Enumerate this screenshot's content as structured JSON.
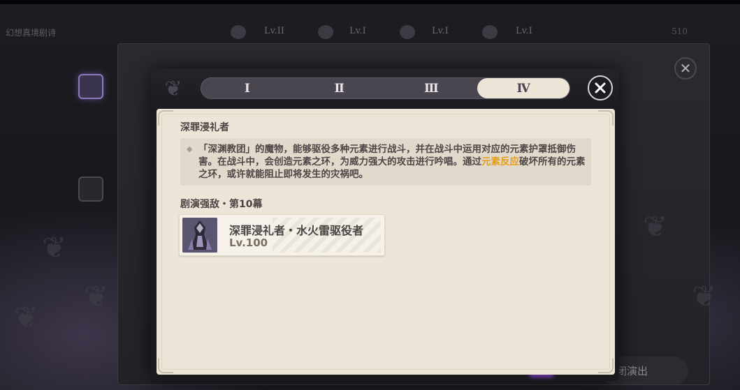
{
  "background": {
    "top_strip": {
      "title": "幻想真境剧诗",
      "levels": [
        "Lv.II",
        "Lv.I",
        "Lv.I",
        "Lv.I"
      ],
      "right_number": "510"
    },
    "bottom_button_label": "闭演出"
  },
  "tabs": [
    {
      "label": "Ⅰ",
      "active": false
    },
    {
      "label": "Ⅱ",
      "active": false
    },
    {
      "label": "Ⅲ",
      "active": false
    },
    {
      "label": "Ⅳ",
      "active": true
    }
  ],
  "enemy": {
    "title": "深罪浸礼者",
    "description_parts": [
      "「深渊教团」的魔物，能够驱役多种元素进行战斗，并在战斗中运用对应的元素护罩抵御伤害。在战斗中，会创造元素之环，为威力强大的攻击进行吟唱。通过",
      "元素反应",
      "破坏所有的元素之环，或许就能阻止即将发生的灾祸吧。"
    ]
  },
  "section": {
    "title": "剧演强敌・第10幕",
    "card": {
      "name": "深罪浸礼者・水火雷驱役者",
      "level": "Lv.100"
    }
  },
  "colors": {
    "panel_bg": "#ece5d8",
    "highlight": "#e59e1b",
    "text_primary": "#4a4444",
    "tab_bar": "#4a4650"
  }
}
